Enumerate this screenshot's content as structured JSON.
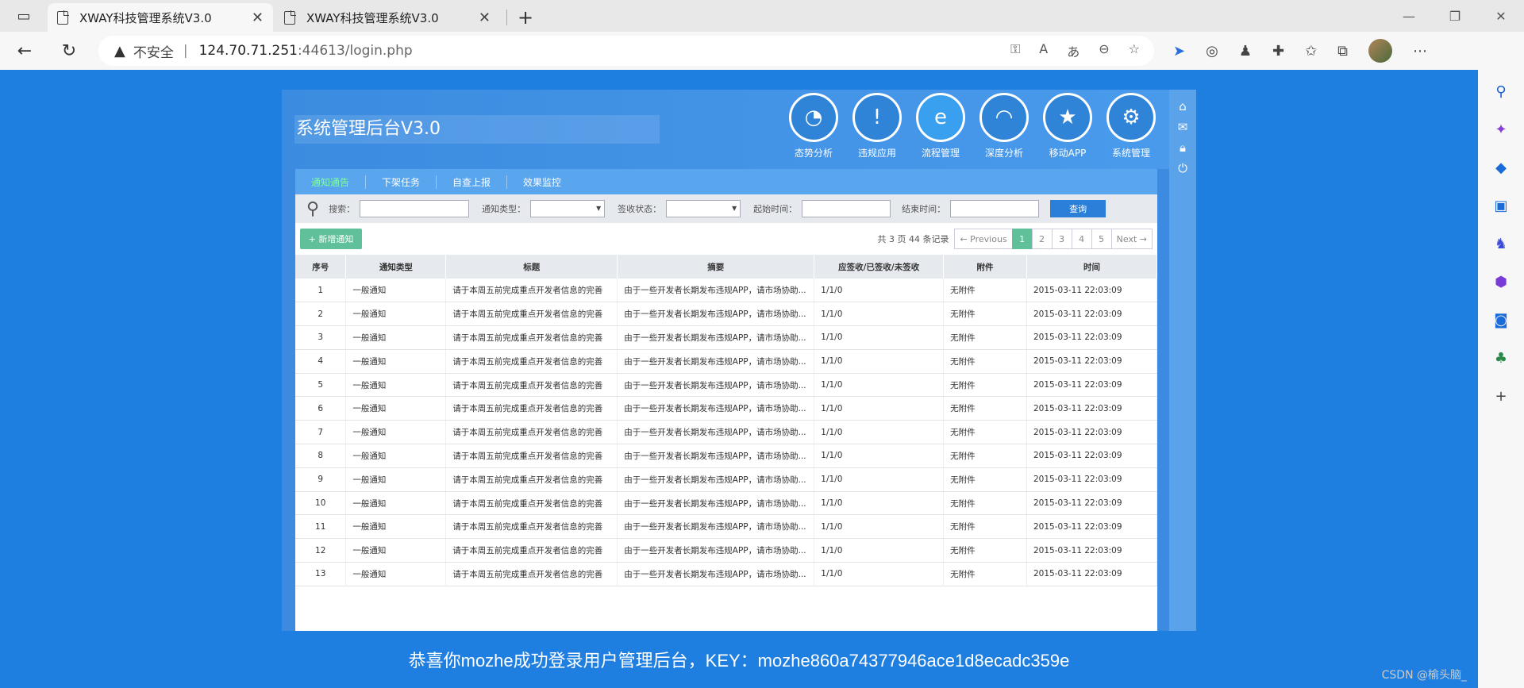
{
  "browser": {
    "tabs": [
      {
        "title": "XWAY科技管理系统V3.0",
        "close": "✕"
      },
      {
        "title": "XWAY科技管理系统V3.0",
        "close": "✕"
      }
    ],
    "new_tab": "+",
    "address": {
      "warning_icon": "warning-icon",
      "insecure_label": "不安全",
      "separator": "|",
      "host": "124.70.71.251",
      "rest": ":44613/login.php"
    }
  },
  "app": {
    "title": "系统管理后台V3.0",
    "modules": [
      {
        "label": "态势分析",
        "icon": "pie-chart-icon",
        "glyph": "◔"
      },
      {
        "label": "违规应用",
        "icon": "warning-icon",
        "glyph": "!"
      },
      {
        "label": "流程管理",
        "icon": "ie-icon",
        "glyph": "e"
      },
      {
        "label": "深度分析",
        "icon": "gauge-icon",
        "glyph": "◠"
      },
      {
        "label": "移动APP",
        "icon": "star-badge-icon",
        "glyph": "★"
      },
      {
        "label": "系统管理",
        "icon": "settings-window-icon",
        "glyph": "⚙"
      }
    ],
    "subtabs": [
      "通知通告",
      "下架任务",
      "自查上报",
      "效果监控"
    ],
    "filters": {
      "search_label": "搜索：",
      "type_label": "通知类型：",
      "status_label": "签收状态：",
      "start_label": "起始时间：",
      "end_label": "结束时间：",
      "query_button": "查询"
    },
    "add_button": "+ 新增通知",
    "pager": {
      "info": "共 3 页 44 条记录",
      "prev": "← Previous",
      "pages": [
        "1",
        "2",
        "3",
        "4",
        "5"
      ],
      "next": "Next →"
    },
    "table": {
      "headers": [
        "序号",
        "通知类型",
        "标题",
        "摘要",
        "应签收/已签收/未签收",
        "附件",
        "时间"
      ],
      "rows": [
        [
          "1",
          "一般通知",
          "请于本周五前完成重点开发者信息的完善",
          "由于一些开发者长期发布违规APP，请市场协助...",
          "1/1/0",
          "无附件",
          "2015-03-11 22:03:09"
        ],
        [
          "2",
          "一般通知",
          "请于本周五前完成重点开发者信息的完善",
          "由于一些开发者长期发布违规APP，请市场协助...",
          "1/1/0",
          "无附件",
          "2015-03-11 22:03:09"
        ],
        [
          "3",
          "一般通知",
          "请于本周五前完成重点开发者信息的完善",
          "由于一些开发者长期发布违规APP，请市场协助...",
          "1/1/0",
          "无附件",
          "2015-03-11 22:03:09"
        ],
        [
          "4",
          "一般通知",
          "请于本周五前完成重点开发者信息的完善",
          "由于一些开发者长期发布违规APP，请市场协助...",
          "1/1/0",
          "无附件",
          "2015-03-11 22:03:09"
        ],
        [
          "5",
          "一般通知",
          "请于本周五前完成重点开发者信息的完善",
          "由于一些开发者长期发布违规APP，请市场协助...",
          "1/1/0",
          "无附件",
          "2015-03-11 22:03:09"
        ],
        [
          "6",
          "一般通知",
          "请于本周五前完成重点开发者信息的完善",
          "由于一些开发者长期发布违规APP，请市场协助...",
          "1/1/0",
          "无附件",
          "2015-03-11 22:03:09"
        ],
        [
          "7",
          "一般通知",
          "请于本周五前完成重点开发者信息的完善",
          "由于一些开发者长期发布违规APP，请市场协助...",
          "1/1/0",
          "无附件",
          "2015-03-11 22:03:09"
        ],
        [
          "8",
          "一般通知",
          "请于本周五前完成重点开发者信息的完善",
          "由于一些开发者长期发布违规APP，请市场协助...",
          "1/1/0",
          "无附件",
          "2015-03-11 22:03:09"
        ],
        [
          "9",
          "一般通知",
          "请于本周五前完成重点开发者信息的完善",
          "由于一些开发者长期发布违规APP，请市场协助...",
          "1/1/0",
          "无附件",
          "2015-03-11 22:03:09"
        ],
        [
          "10",
          "一般通知",
          "请于本周五前完成重点开发者信息的完善",
          "由于一些开发者长期发布违规APP，请市场协助...",
          "1/1/0",
          "无附件",
          "2015-03-11 22:03:09"
        ],
        [
          "11",
          "一般通知",
          "请于本周五前完成重点开发者信息的完善",
          "由于一些开发者长期发布违规APP，请市场协助...",
          "1/1/0",
          "无附件",
          "2015-03-11 22:03:09"
        ],
        [
          "12",
          "一般通知",
          "请于本周五前完成重点开发者信息的完善",
          "由于一些开发者长期发布违规APP，请市场协助...",
          "1/1/0",
          "无附件",
          "2015-03-11 22:03:09"
        ],
        [
          "13",
          "一般通知",
          "请于本周五前完成重点开发者信息的完善",
          "由于一些开发者长期发布违规APP，请市场协助...",
          "1/1/0",
          "无附件",
          "2015-03-11 22:03:09"
        ]
      ]
    }
  },
  "message": "恭喜你mozhe成功登录用户管理后台，KEY：mozhe860a74377946ace1d8ecadc359e",
  "watermark": "CSDN @榆头脑_",
  "colors": {
    "page_bg": "#1f7fe0",
    "accent_green": "#5fc09a",
    "query_blue": "#2a7fd8"
  }
}
